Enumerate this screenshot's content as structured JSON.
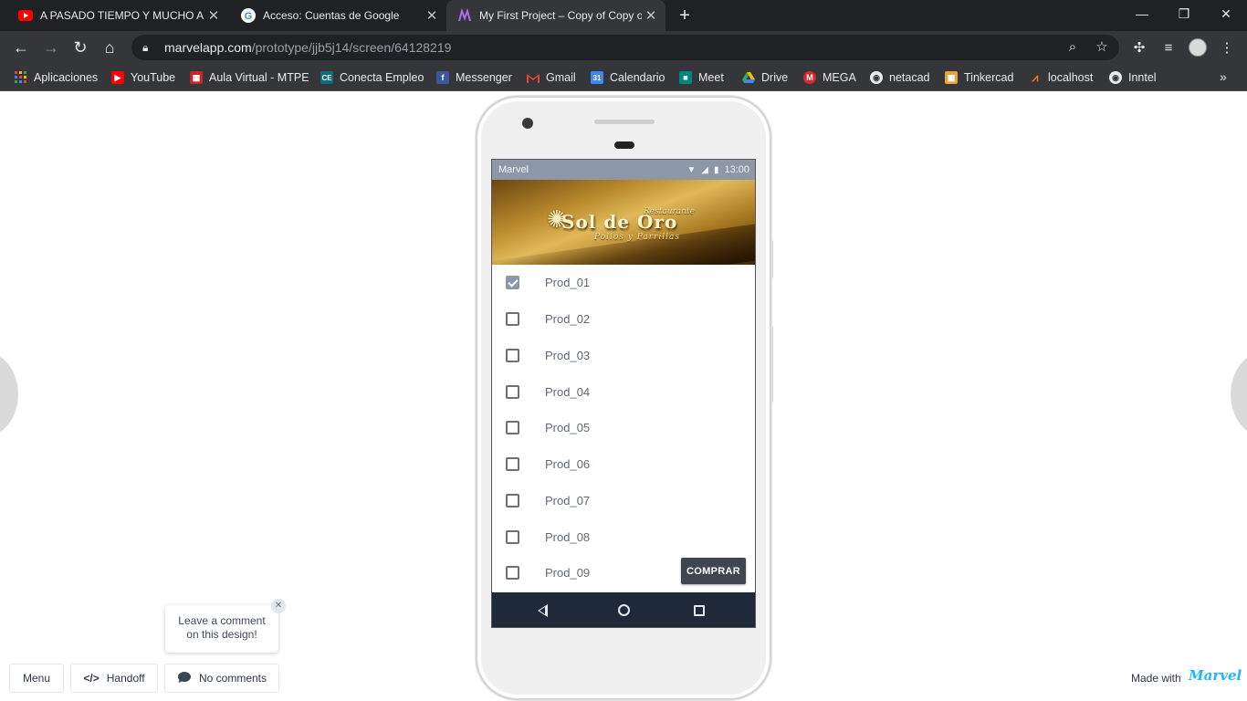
{
  "browser": {
    "tabs": [
      {
        "title": "A PASADO TIEMPO Y MUCHO A",
        "favicon": "youtube-icon"
      },
      {
        "title": "Acceso: Cuentas de Google",
        "favicon": "google-icon"
      },
      {
        "title": "My First Project – Copy of Copy o",
        "favicon": "marvel-icon"
      }
    ],
    "url_host": "marvelapp.com",
    "url_path": "/prototype/jjb5j14/screen/64128219",
    "bookmarks": [
      {
        "label": "Aplicaciones",
        "icon": "apps-icon",
        "color": "#e94235"
      },
      {
        "label": "YouTube",
        "icon": "youtube-icon",
        "color": "#ff0000"
      },
      {
        "label": "Aula Virtual - MTPE",
        "icon": "mtpe-icon",
        "color": "#c62828"
      },
      {
        "label": "Conecta Empleo",
        "icon": "ce-icon",
        "color": "#0c6b7a"
      },
      {
        "label": "Messenger",
        "icon": "facebook-icon",
        "color": "#3b5998"
      },
      {
        "label": "Gmail",
        "icon": "gmail-icon",
        "color": "#ea4335"
      },
      {
        "label": "Calendario",
        "icon": "calendar-icon",
        "color": "#4285f4"
      },
      {
        "label": "Meet",
        "icon": "meet-icon",
        "color": "#00897b"
      },
      {
        "label": "Drive",
        "icon": "drive-icon",
        "color": "#fbbc04"
      },
      {
        "label": "MEGA",
        "icon": "mega-icon",
        "color": "#d9272e"
      },
      {
        "label": "netacad",
        "icon": "globe-icon",
        "color": "#5f6368"
      },
      {
        "label": "Tinkercad",
        "icon": "tinkercad-icon",
        "color": "#e8a33d"
      },
      {
        "label": "localhost",
        "icon": "xampp-icon",
        "color": "#fb7a24"
      },
      {
        "label": "Inntel",
        "icon": "globe-icon",
        "color": "#5f6368"
      }
    ]
  },
  "phone": {
    "status": {
      "carrier": "Marvel",
      "time": "13:00"
    },
    "banner": {
      "pre": "Restaurante",
      "brand": "Sol de Oro",
      "sub": "Pollos y Parrillas"
    },
    "products": [
      {
        "label": "Prod_01",
        "checked": true
      },
      {
        "label": "Prod_02",
        "checked": false
      },
      {
        "label": "Prod_03",
        "checked": false
      },
      {
        "label": "Prod_04",
        "checked": false
      },
      {
        "label": "Prod_05",
        "checked": false
      },
      {
        "label": "Prod_06",
        "checked": false
      },
      {
        "label": "Prod_07",
        "checked": false
      },
      {
        "label": "Prod_08",
        "checked": false
      },
      {
        "label": "Prod_09",
        "checked": false
      }
    ],
    "buy_label": "COMPRAR"
  },
  "comment": {
    "line1": "Leave a comment",
    "line2": "on this design!"
  },
  "footer": {
    "menu_label": "Menu",
    "handoff_label": "Handoff",
    "comments_label": "No comments",
    "made_with": "Made with",
    "marvel": "Marvel"
  }
}
